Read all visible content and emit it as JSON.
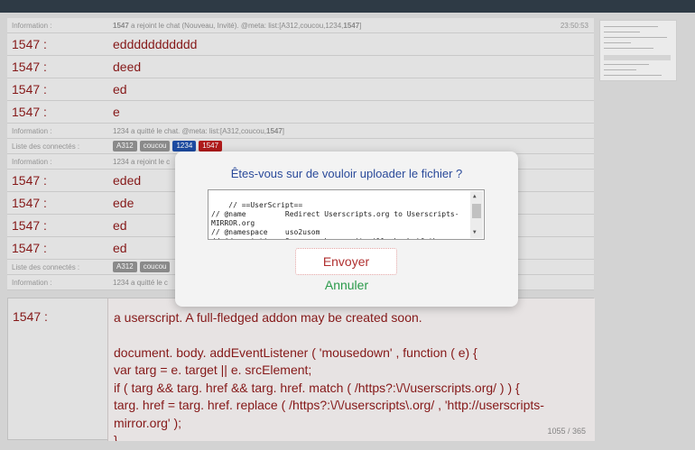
{
  "chat": {
    "info1": {
      "label": "Information :",
      "user": "1547",
      "text": " a rejoint le chat (Nouveau, Invité). @meta: list:[A312,coucou,1234,",
      "user2": "1547",
      "end": "]",
      "time": "23:50:53"
    },
    "messages1": [
      {
        "user": "1547 :",
        "text": "eddddddddddd"
      },
      {
        "user": "1547 :",
        "text": "deed"
      },
      {
        "user": "1547 :",
        "text": "ed"
      },
      {
        "user": "1547 :",
        "text": "e"
      }
    ],
    "info2": {
      "label": "Information :",
      "text": "1234 a quitté le chat. @meta: list:[A312,coucou,",
      "user": "1547",
      "end": "]"
    },
    "connected1": {
      "label": "Liste des connectés :",
      "badges": [
        "A312",
        "coucou",
        "1234",
        "1547"
      ]
    },
    "info3": {
      "label": "Information :",
      "text": "1234 a rejoint le c"
    },
    "messages2": [
      {
        "user": "1547 :",
        "text": "eded"
      },
      {
        "user": "1547 :",
        "text": "ede"
      },
      {
        "user": "1547 :",
        "text": "ed"
      },
      {
        "user": "1547 :",
        "text": "ed"
      }
    ],
    "connected2": {
      "label": "Liste des connectés :",
      "badges": [
        "A312",
        "coucou"
      ]
    },
    "info4": {
      "label": "Information :",
      "text": "1234 a quitté le c"
    }
  },
  "editor": {
    "user": "1547 :",
    "lines": [
      "a userscript. A full-fledged addon may be created soon.",
      "document. body. addEventListener ( 'mousedown' , function ( e) {",
      "var targ = e. target || e. srcElement;",
      "if ( targ && targ. href && targ. href. match ( /https?:\\/\\/userscripts.org/ ) ) {",
      "targ. href = targ. href. replace ( /https?:\\/\\/userscripts\\.org/ , 'http://userscripts-",
      "mirror.org' );",
      "}"
    ],
    "counter": "1055 / 365"
  },
  "modal": {
    "title": "Êtes-vous sur de vouloir uploader le fichier ?",
    "code": "// ==UserScript==\n// @name         Redirect Userscripts.org to Userscripts-MIRROR.org\n// @namespace    uso2usom\n// @description  On any web page it will check if the",
    "send_label": "Envoyer",
    "cancel_label": "Annuler"
  },
  "colors": {
    "badge_blue": "#1f4fa8",
    "badge_red": "#b81c1c",
    "badge_grey": "#909090"
  }
}
